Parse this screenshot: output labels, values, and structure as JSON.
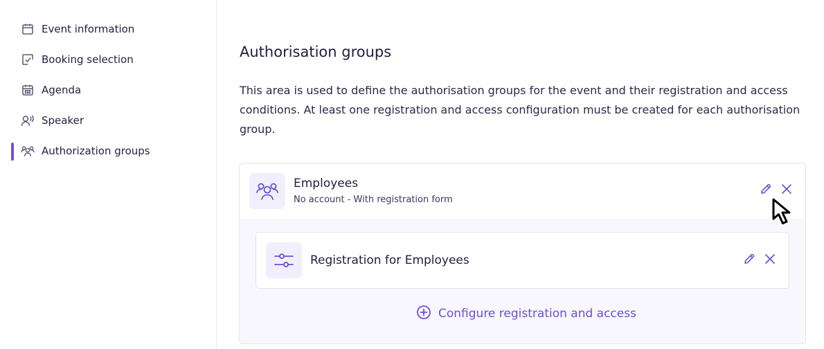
{
  "sidebar": {
    "items": [
      {
        "label": "Event information",
        "icon": "calendar-icon",
        "active": false
      },
      {
        "label": "Booking selection",
        "icon": "checkbox-icon",
        "active": false
      },
      {
        "label": "Agenda",
        "icon": "calendar-grid-icon",
        "active": false
      },
      {
        "label": "Speaker",
        "icon": "speaker-icon",
        "active": false
      },
      {
        "label": "Authorization groups",
        "icon": "users-icon",
        "active": true
      }
    ]
  },
  "main": {
    "title": "Authorisation groups",
    "description": "This area is used to define the authorisation groups for the event and their registration and access conditions. At least one registration and access configuration must be created for each authorisation group.",
    "group": {
      "name": "Employees",
      "subtitle": "No account - With registration form",
      "icon": "users-icon",
      "registration": {
        "name": "Registration for Employees",
        "icon": "sliders-icon"
      },
      "configure_label": "Configure registration and access"
    }
  },
  "colors": {
    "accent": "#6b4fd8",
    "icon_bg": "#f1effb",
    "text": "#1f1d3d"
  }
}
